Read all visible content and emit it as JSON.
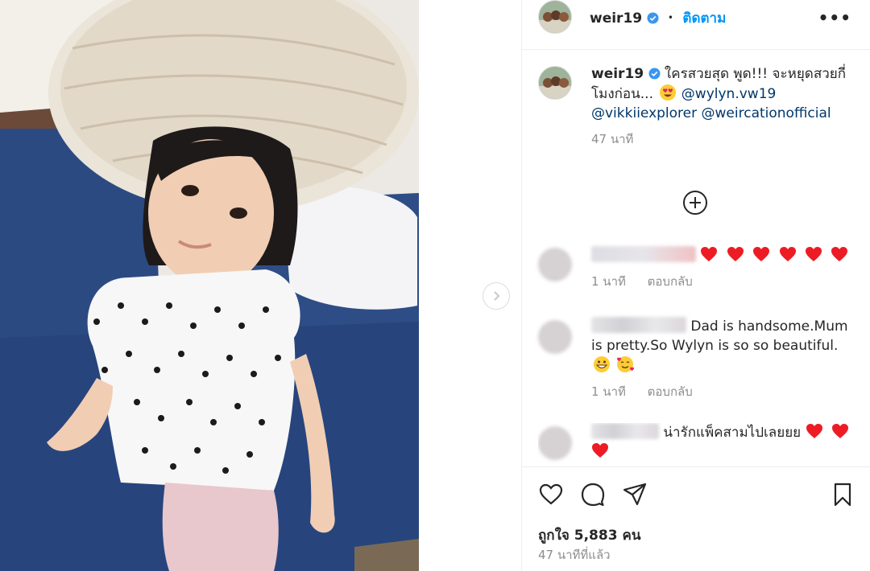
{
  "post": {
    "username": "weir19",
    "follow_label": "ติดตาม",
    "more_label": "•••",
    "caption": {
      "text": "ใครสวยสุด พูด!!! จะหยุดสวยกี่โมงก่อน...",
      "mentions": [
        "@wylyn.vw19",
        "@vikkiiexplorer",
        "@weircationofficial"
      ],
      "time": "47 นาที"
    },
    "comments": [
      {
        "text": "",
        "hearts": 6,
        "time": "1 นาที",
        "reply_label": "ตอบกลับ"
      },
      {
        "text": "Dad is handsome.Mum is pretty.So Wylyn is so so beautiful.",
        "emojis": [
          "grinning-face",
          "smiling-face-with-hearts"
        ],
        "time": "1 นาที",
        "reply_label": "ตอบกลับ"
      },
      {
        "text": "น่ารักแพ็คสามไปเลยยย",
        "hearts": 3
      }
    ],
    "likes_label": "ถูกใจ 5,883 คน",
    "posted_ago": "47 นาทีที่แล้ว"
  },
  "colors": {
    "link_blue": "#0095f6",
    "mention_blue": "#00376b",
    "muted": "#8e8e8e",
    "heart_red": "#ed1c24"
  },
  "icons": [
    "verified-badge-icon",
    "more-options-icon",
    "load-more-icon",
    "heart-icon",
    "comment-icon",
    "share-icon",
    "bookmark-icon",
    "next-arrow-icon"
  ]
}
